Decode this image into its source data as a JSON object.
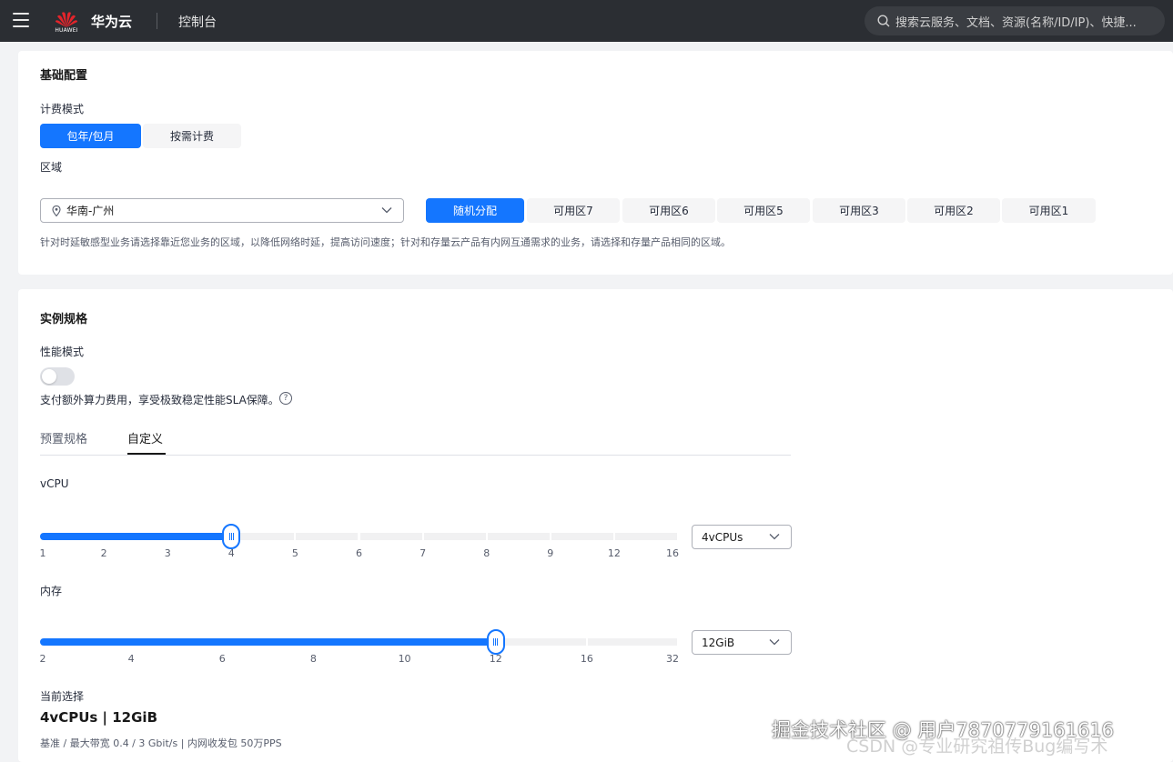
{
  "header": {
    "brand": "华为云",
    "logo_text": "HUAWEI",
    "console": "控制台",
    "search_placeholder": "搜索云服务、文档、资源(名称/ID/IP)、快捷..."
  },
  "basic": {
    "title": "基础配置",
    "billing_label": "计费模式",
    "billing_options": [
      "包年/包月",
      "按需计费"
    ],
    "billing_selected": "包年/包月",
    "region_label": "区域",
    "region_value": "华南-广州",
    "az_options": [
      "随机分配",
      "可用区7",
      "可用区6",
      "可用区5",
      "可用区3",
      "可用区2",
      "可用区1"
    ],
    "az_selected": "随机分配",
    "hint": "针对时延敏感型业务请选择靠近您业务的区域，以降低网络时延，提高访问速度；针对和存量云产品有内网互通需求的业务，请选择和存量产品相同的区域。"
  },
  "instance": {
    "title": "实例规格",
    "perf_label": "性能模式",
    "perf_enabled": false,
    "perf_hint": "支付额外算力费用，享受极致稳定性能SLA保障。",
    "help": "?",
    "tabs": [
      "预置规格",
      "自定义"
    ],
    "active_tab": "自定义",
    "vcpu": {
      "label": "vCPU",
      "ticks": [
        "1",
        "2",
        "3",
        "4",
        "5",
        "6",
        "7",
        "8",
        "9",
        "12",
        "16"
      ],
      "selected_index": 3,
      "dropdown": "4vCPUs"
    },
    "memory": {
      "label": "内存",
      "ticks": [
        "2",
        "4",
        "6",
        "8",
        "10",
        "12",
        "16",
        "32"
      ],
      "selected_index": 5,
      "dropdown": "12GiB"
    },
    "current_label": "当前选择",
    "current_value": "4vCPUs | 12GiB",
    "spec_line": "基准 / 最大带宽  0.4 / 3 Gbit/s  |  内网收发包  50万PPS"
  },
  "watermarks": {
    "juejin": "掘金技术社区 @ 用户7870779161616",
    "csdn": "CSDN @专业研究祖传Bug编写术"
  }
}
